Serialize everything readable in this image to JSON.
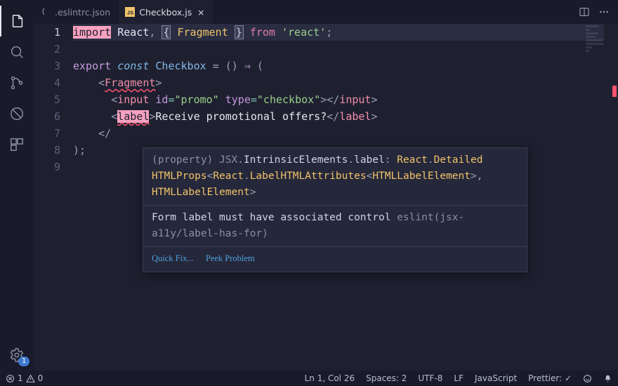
{
  "tabs": {
    "t0": {
      "name": ".eslintrc.json"
    },
    "t1": {
      "name": "Checkbox.js",
      "close": "×"
    }
  },
  "gutter": {
    "l1": "1",
    "l2": "2",
    "l3": "3",
    "l4": "4",
    "l5": "5",
    "l6": "6",
    "l7": "7",
    "l8": "8",
    "l9": "9"
  },
  "code": {
    "l1": {
      "import": "import",
      "sp": " ",
      "react": "React",
      "comma": ", ",
      "ob": "{",
      "sp2": " ",
      "frag": "Fragment",
      "sp3": " ",
      "cb": "}",
      "sp4": " ",
      "from": "from",
      "sp5": " ",
      "str": "'react'",
      "semi": ";"
    },
    "l3": {
      "export": "export",
      "sp": " ",
      "const": "const",
      "sp2": " ",
      "name": "Checkbox",
      "sp3": " ",
      "eq": "=",
      "sp4": " ",
      "op": "(",
      "cp": ")",
      "sp5": " ",
      "arrow": "⇒",
      "sp6": " ",
      "open": "("
    },
    "l4": {
      "indent": "    ",
      "lt": "<",
      "frag": "Fragment",
      "gt": ">"
    },
    "l5": {
      "indent": "      ",
      "lt": "<",
      "tag": "input",
      "sp": " ",
      "a1": "id",
      "eq1": "=",
      "v1": "\"promo\"",
      "sp2": " ",
      "a2": "type",
      "eq2": "=",
      "v2": "\"checkbox\"",
      "gt": ">",
      "lct": "</",
      "ctag": "input",
      "cgt": ">"
    },
    "l6": {
      "indent": "      ",
      "lt": "<",
      "tag": "label",
      "gt": ">",
      "text": "Receive promotional offers?",
      "lct": "</",
      "ctag": "label",
      "cgt": ">"
    },
    "l7": {
      "indent": "    ",
      "lct": "</"
    },
    "l8": {
      "close": ");"
    }
  },
  "hover": {
    "sig_pre": "(property) JSX",
    "sig_dot1": ".",
    "sig_ie": "IntrinsicElements",
    "sig_dot2": ".",
    "sig_label": "label",
    "sig_colon": ": ",
    "sig_react": "React",
    "sig_dot3": ".",
    "sig_detailed": "Detailed",
    "sig_line2a": "HTMLProps",
    "sig_lt": "<",
    "sig_line2b": "React",
    "sig_dot4": ".",
    "sig_line2c": "LabelHTMLAttributes",
    "sig_lt2": "<",
    "sig_line2d": "HTMLLabelElement",
    "sig_gt": ">",
    "sig_comma": ",",
    "sig_line3a": " HTMLLabelElement",
    "sig_gt2": ">",
    "msg_main": "Form label must have associated control ",
    "msg_src": "eslint(jsx-a11y/label-has-for)",
    "quickfix": "Quick Fix...",
    "peek": "Peek Problem"
  },
  "status": {
    "errors": "1",
    "warnings": "0",
    "lncol": "Ln 1, Col 26",
    "spaces": "Spaces: 2",
    "enc": "UTF-8",
    "eol": "LF",
    "lang": "JavaScript",
    "prettier": "Prettier: ✓"
  },
  "settings_badge": "1"
}
